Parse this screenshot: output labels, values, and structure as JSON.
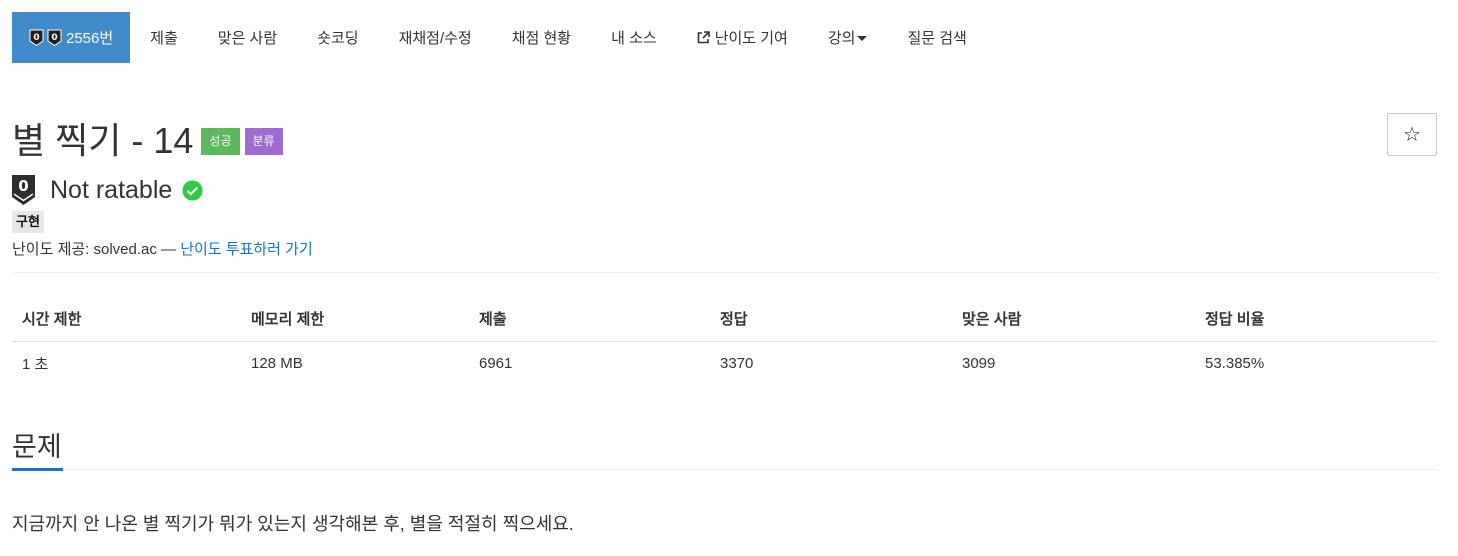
{
  "tabs": {
    "problem_label": "2556번",
    "items": [
      {
        "key": "submit",
        "label": "제출"
      },
      {
        "key": "solved",
        "label": "맞은 사람"
      },
      {
        "key": "short",
        "label": "숏코딩"
      },
      {
        "key": "rejudge",
        "label": "재채점/수정"
      },
      {
        "key": "status",
        "label": "채점 현황"
      },
      {
        "key": "mysource",
        "label": "내 소스"
      },
      {
        "key": "difficulty",
        "label": "난이도 기여"
      },
      {
        "key": "lecture",
        "label": "강의"
      },
      {
        "key": "qna",
        "label": "질문 검색"
      }
    ]
  },
  "problem": {
    "title": "별 찍기 - 14",
    "badge_success": "성공",
    "badge_category": "분류",
    "star_label": "☆",
    "tier_digit": "0",
    "tier_text": "Not ratable",
    "tag": "구현",
    "credit_prefix": "난이도 제공: solved.ac — ",
    "credit_link": "난이도 투표하러 가기"
  },
  "table": {
    "headers": [
      "시간 제한",
      "메모리 제한",
      "제출",
      "정답",
      "맞은 사람",
      "정답 비율"
    ],
    "values": [
      "1 초",
      "128 MB",
      "6961",
      "3370",
      "3099",
      "53.385%"
    ]
  },
  "section": {
    "title": "문제",
    "description": "지금까지 안 나온 별 찍기가 뭐가 있는지 생각해본 후, 별을 적절히 찍으세요."
  },
  "colors": {
    "active_tab": "#428bca",
    "success": "#5cb85c",
    "category": "#9f6bd2",
    "link": "#1a73c9",
    "check": "#2ecc40"
  },
  "icons": {
    "tier": "unrated-shield-icon",
    "check": "check-circle-icon",
    "external": "external-link-icon",
    "star": "star-outline-icon"
  }
}
